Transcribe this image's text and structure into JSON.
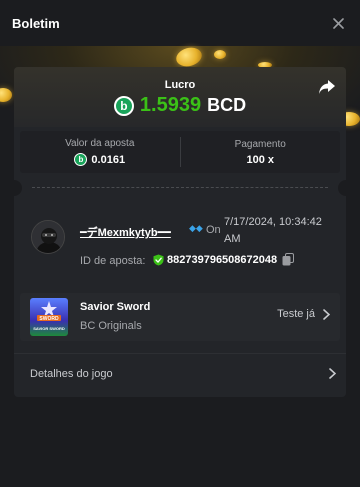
{
  "header": {
    "title": "Boletim"
  },
  "profit": {
    "label": "Lucro",
    "amount": "1.5939",
    "currency": "BCD",
    "coin_letter": "b",
    "color": "#3bc117"
  },
  "stats": [
    {
      "label": "Valor da aposta",
      "value": "0.0161",
      "has_coin": true
    },
    {
      "label": "Pagamento",
      "value": "100 x",
      "has_coin": false
    }
  ],
  "bet": {
    "username": "━デMexmkytyb━━",
    "on_label": "On",
    "timestamp": "7/17/2024, 10:34:42 AM",
    "id_label": "ID de aposta:",
    "id_value": "882739796508672048"
  },
  "game": {
    "name": "Savior Sword",
    "provider": "BC Originals",
    "thumb_text_top": "SWORD",
    "thumb_text_bottom": "SAVIOR SWORD",
    "try_label": "Teste já"
  },
  "details": {
    "label": "Detalhes do jogo"
  },
  "colors": {
    "brand_green": "#19a35a",
    "profit_green": "#3bc117",
    "background": "#1b1c1f",
    "card": "#232529"
  }
}
